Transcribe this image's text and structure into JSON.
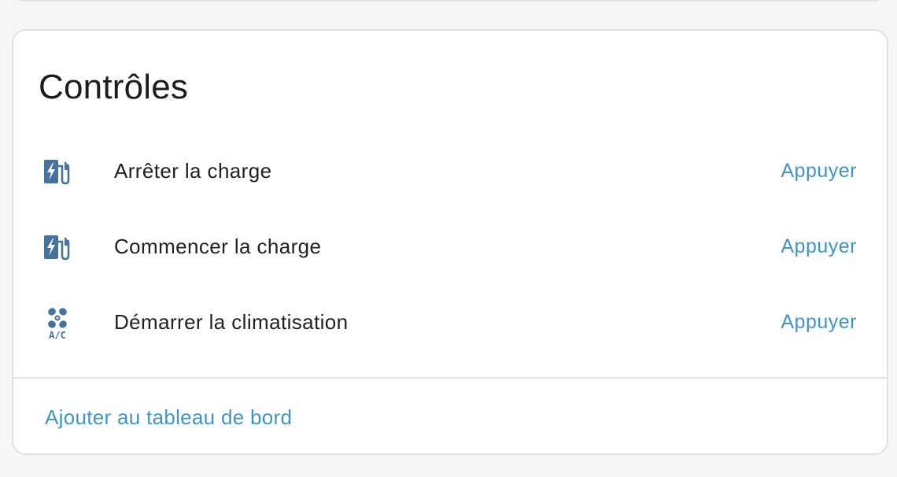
{
  "card": {
    "title": "Contrôles",
    "rows": [
      {
        "icon": "ev-station-icon",
        "label": "Arrêter la charge",
        "action": "Appuyer"
      },
      {
        "icon": "ev-station-icon",
        "label": "Commencer la charge",
        "action": "Appuyer"
      },
      {
        "icon": "air-conditioner-icon",
        "label": "Démarrer la climatisation",
        "action": "Appuyer",
        "icon_text": "A/C"
      }
    ],
    "footer_link": "Ajouter au tableau de bord"
  },
  "colors": {
    "accent": "#3e96c6",
    "icon": "#44739e",
    "text": "#212121",
    "border": "#e0e0e0"
  }
}
